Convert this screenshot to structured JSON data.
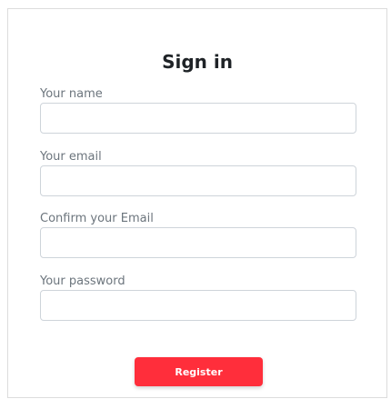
{
  "form": {
    "title": "Sign in",
    "fields": [
      {
        "label": "Your name",
        "value": "",
        "placeholder": ""
      },
      {
        "label": "Your email",
        "value": "",
        "placeholder": ""
      },
      {
        "label": "Confirm your Email",
        "value": "",
        "placeholder": ""
      },
      {
        "label": "Your password",
        "value": "",
        "placeholder": ""
      }
    ],
    "submit_label": "Register"
  },
  "colors": {
    "accent": "#ff2e3b",
    "border": "#ced4da",
    "label": "#6c757d",
    "title": "#1f2327"
  }
}
